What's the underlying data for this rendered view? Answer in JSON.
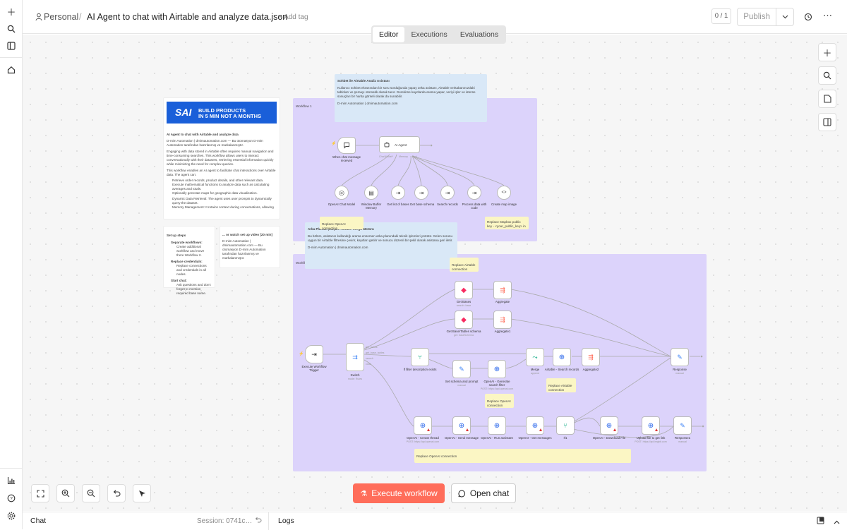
{
  "breadcrumb": {
    "project": "Personal",
    "separator": "/",
    "workflow_name": "AI Agent to chat with Airtable and analyze data.json",
    "add_tag": "+ Add tag"
  },
  "header": {
    "version": "0 / 1",
    "publish": "Publish"
  },
  "tabs": [
    "Editor",
    "Executions",
    "Evaluations"
  ],
  "sticky_top": {
    "title": "Sohbet ile Airtable Analiz Asistanı",
    "body": "Kullanıcı sohbet ekranından bir soru sorduğunda yapay zeka asistanı, Airtable veritabanınızdaki tabloları ve şemayı otomatik olarak tanır. Gerekirse kayıtlarda arama yapar, veriyi işler ve isterse sonuçları bir harita görseli olarak da sunabilir.",
    "footer": "D-mim Automation | dmimautomation.com"
  },
  "sticky_bottom": {
    "title": "Arka Planda Çalışan Airtable Sorgu Motoru",
    "body": "Bu bölüm, asistanın kullandığı arama ensomen arka planındaki teknik işlemleri yürütür. Gelen sorunu uygun bir Airtable filtresine çevirir, kayıtları getirir ve sonucu düzenli bir şekil olarak asistana geri iletir.",
    "footer": "D-mim Automation | dmimautomation.com"
  },
  "workflow_labels": {
    "w1": "Workflow 1",
    "w2": "Workflow 2"
  },
  "notes": {
    "openai_conn": "Replace OpenAI connection",
    "mapbox": "Replace Mapbox public key - <your_public_key> in",
    "airtable_conn": "Replace Airtable connection",
    "airtable_conn2": "Replace Airtable connection",
    "openai_conn2": "Replace OpenAI connection",
    "openai_conn3": "Replace OpenAI connection"
  },
  "doc": {
    "banner_line1": "BUILD PRODUCTS",
    "banner_line2": "IN 5 MIN NOT A MONTHS",
    "banner_logo": "SAI",
    "title": "AI Agent to chat with Airtable and analyze data",
    "credit": "D-mim Automation | dmimautomation.com — Bu otomasyon D-mim Automation tarafından hazırlanmış ve markalanmıştır.",
    "p1": "Engaging with data stored in Airtable often requires manual navigation and time-consuming searches. This workflow allows users to interact conversationally with their datasets, retrieving essential information quickly while minimizing the need for complex queries.",
    "p2": "This workflow enables an AI agent to facilitate chat interactions over Airtable data. The agent can:",
    "li1": "Retrieve order records, product details, and other relevant data.",
    "li2": "Execute mathematical functions to analyze data such as calculating averages and totals.",
    "li3": "Optionally generate maps for geographic data visualization.",
    "li4": "Dynamic Data Retrieval: The agent uses user prompts to dynamically query the dataset.",
    "li5": "Memory Management: It retains context during conversations, allowing users to"
  },
  "setup": {
    "title": "Set up steps",
    "s1": "Separate workflows:",
    "s1a": "Create additional workflow and move there Workflow 2.",
    "s2": "Replace credentials:",
    "s2a": "Replace connections and credentials in all nodes.",
    "s3": "Start chat:",
    "s3a": "Ask questions and don't forget to mention required base name."
  },
  "video": {
    "title": "... or watch set up video [20 min]",
    "body": "D-mim Automation | dmimautomation.com — Bu otomasyon D-mim Automation tarafından hazırlanmış ve markalanmıştır."
  },
  "nodes_w1": {
    "trigger": "When chat message received",
    "agent": "AI Agent",
    "model_sub": "Chat Model*",
    "memory_sub": "Memory",
    "tool_sub": "Tool",
    "llm": "OpenAI Chat Model",
    "memory": "Window Buffer Memory",
    "t1": "Get list of bases",
    "t2": "Get base schema",
    "t3": "Search records",
    "t4": "Process data with code",
    "t5": "Create map image"
  },
  "nodes_w2": {
    "exec": "Execute Workflow Trigger",
    "switch": "Switch",
    "switch_sub": "mode: Rules",
    "get_bases": "Get Bases",
    "get_bases_sub": "search: base",
    "aggregate": "Aggregate",
    "get_schema": "Get Base/Tables schema",
    "get_schema_sub": "get: baseSchema",
    "aggregate1": "Aggregate1",
    "if_filter": "If filter description exists",
    "set_schema": "Set schema and prompt",
    "set_sub": "manual",
    "openai_gen": "OpenAI - Generate search filter",
    "openai_gen_sub": "POST: https://api.openai.com",
    "merge": "Merge",
    "merge_sub": "append",
    "airtable_search": "Airtable - Search records",
    "aggregate2": "Aggregate2",
    "response": "Response",
    "response_sub": "manual",
    "r1": "OpenAI - Create thread",
    "r1_sub": "POST: https://api.openai.com",
    "r2": "OpenAI - Send message",
    "r3": "OpenAI - Run assistant",
    "r4": "OpenAI - Get messages",
    "if1": "If1",
    "r5": "OpenAI - Download File",
    "r6": "Upload file to get link",
    "r6_sub": "POST: https://api.imgbb.com",
    "r7": "Response1",
    "r7_sub": "manual",
    "sw_out1": "get_bases",
    "sw_out2": "get_base_tables",
    "sw_out3": "search",
    "sw_out4": "code"
  },
  "bottom": {
    "execute": "Execute workflow",
    "open_chat": "Open chat"
  },
  "panel": {
    "chat": "Chat",
    "session": "Session: 0741c…",
    "logs": "Logs"
  },
  "colors": {
    "accent": "#ff6d5a",
    "purple_sticky": "#dcd3fb",
    "blue_sticky": "#d9e8f7",
    "yellow_sticky": "#fbf6c4"
  }
}
